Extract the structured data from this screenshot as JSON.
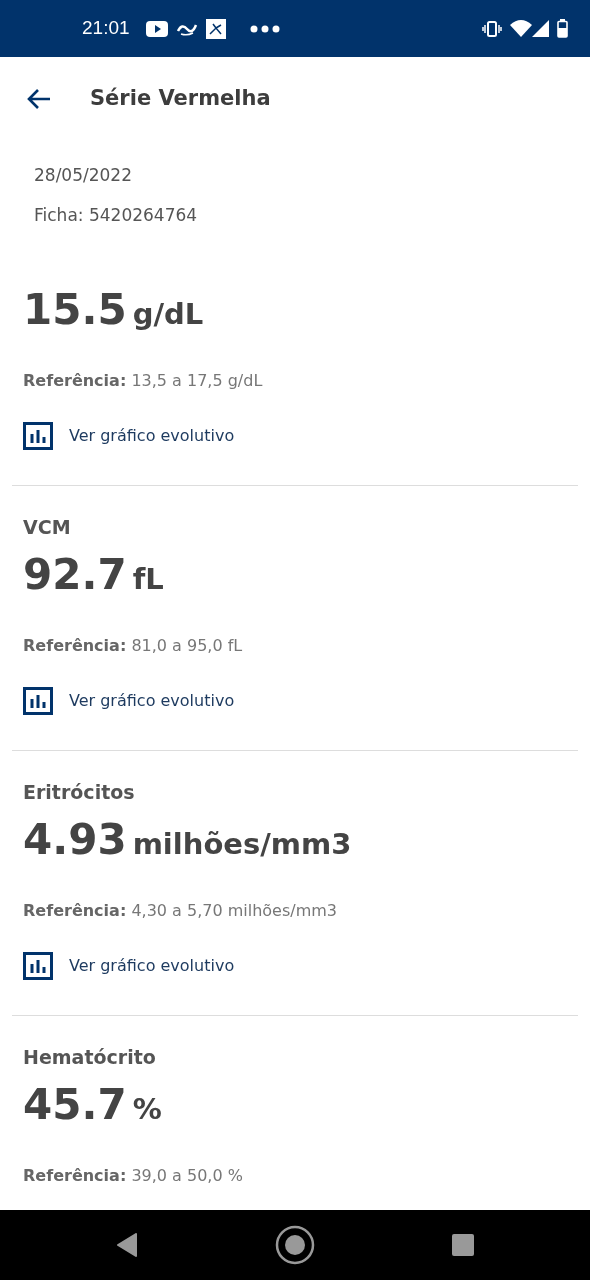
{
  "status_bar": {
    "time": "21:01"
  },
  "header": {
    "title": "Série Vermelha"
  },
  "info": {
    "date": "28/05/2022",
    "record": "Ficha: 5420264764"
  },
  "results": [
    {
      "value": "15.5",
      "unit": "g/dL",
      "reference_label": "Referência:",
      "reference": "13,5 a 17,5 g/dL",
      "link": "Ver gráfico evolutivo"
    },
    {
      "name": "VCM",
      "value": "92.7",
      "unit": "fL",
      "reference_label": "Referência:",
      "reference": "81,0 a 95,0 fL",
      "link": "Ver gráfico evolutivo"
    },
    {
      "name": "Eritrócitos",
      "value": "4.93",
      "unit": "milhões/mm3",
      "reference_label": "Referência:",
      "reference": "4,30 a 5,70 milhões/mm3",
      "link": "Ver gráfico evolutivo"
    },
    {
      "name": "Hematócrito",
      "value": "45.7",
      "unit": "%",
      "reference_label": "Referência:",
      "reference": "39,0 a 50,0 %"
    }
  ]
}
